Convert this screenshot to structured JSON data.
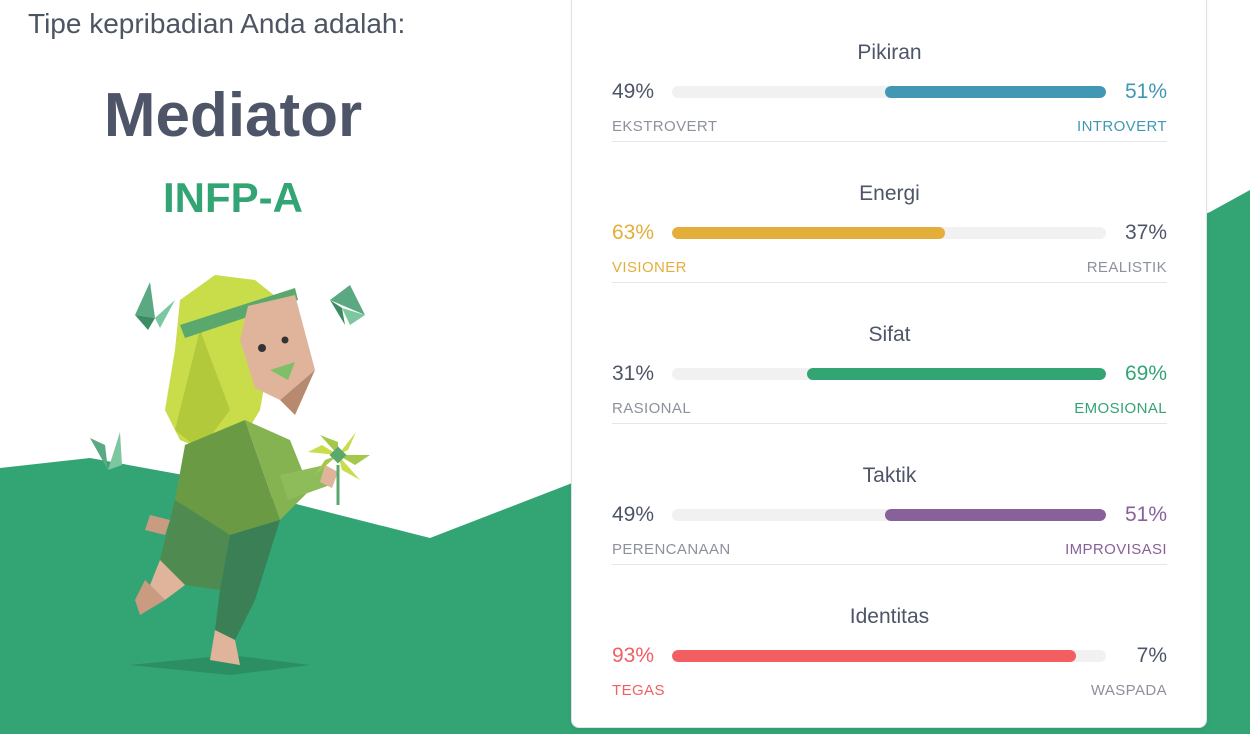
{
  "intro_text": "Tipe kepribadian Anda adalah:",
  "type_name": "Mediator",
  "type_code": "INFP-A",
  "colors": {
    "background_green": "#33a474",
    "blue": "#4298b4",
    "yellow": "#e4ae3a",
    "green": "#33a474",
    "purple": "#88619a",
    "red": "#f25e62",
    "neutral_text": "#4e5568",
    "neutral_label": "#8c919c"
  },
  "traits": [
    {
      "title": "Pikiran",
      "left_pct": "49%",
      "right_pct": "51%",
      "left_label": "EKSTROVERT",
      "right_label": "INTROVERT",
      "dominant": "right",
      "fraction": 0.51,
      "color": "#4298b4"
    },
    {
      "title": "Energi",
      "left_pct": "63%",
      "right_pct": "37%",
      "left_label": "VISIONER",
      "right_label": "REALISTIK",
      "dominant": "left",
      "fraction": 0.63,
      "color": "#e4ae3a"
    },
    {
      "title": "Sifat",
      "left_pct": "31%",
      "right_pct": "69%",
      "left_label": "RASIONAL",
      "right_label": "EMOSIONAL",
      "dominant": "right",
      "fraction": 0.69,
      "color": "#33a474"
    },
    {
      "title": "Taktik",
      "left_pct": "49%",
      "right_pct": "51%",
      "left_label": "PERENCANAAN",
      "right_label": "IMPROVISASI",
      "dominant": "right",
      "fraction": 0.51,
      "color": "#88619a"
    },
    {
      "title": "Identitas",
      "left_pct": "93%",
      "right_pct": "7%",
      "left_label": "TEGAS",
      "right_label": "WASPADA",
      "dominant": "left",
      "fraction": 0.93,
      "color": "#f25e62"
    }
  ]
}
